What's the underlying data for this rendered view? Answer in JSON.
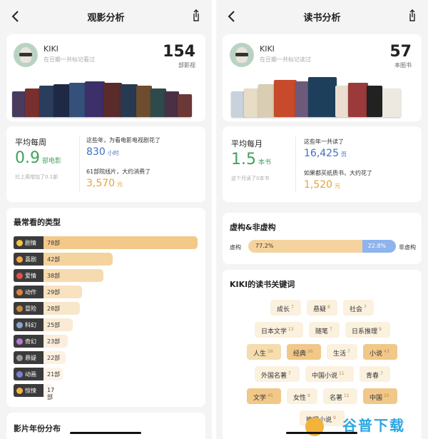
{
  "left": {
    "title": "观影分析",
    "profile": {
      "name": "KIKI",
      "subtitle": "在豆瓣一共标记看过",
      "count": "154",
      "count_label": "部影视"
    },
    "stats": {
      "avg_label": "平均每周",
      "avg_value": "0.9",
      "avg_unit": "部电影",
      "avg_note": "比上周增加了0.1部",
      "time_text": "这些年，为看电影电视剧花了",
      "time_value": "830",
      "time_unit": "小时",
      "cost_text": "61部院线片，大约消费了",
      "cost_value": "3,570",
      "cost_unit": "元"
    },
    "genres": {
      "title": "最常看的类型",
      "items": [
        {
          "name": "剧情",
          "value": "78部",
          "count": 78,
          "color": "#f3c98a",
          "icon": "drama-icon"
        },
        {
          "name": "喜剧",
          "value": "42部",
          "count": 42,
          "color": "#f5d39e",
          "icon": "comedy-icon"
        },
        {
          "name": "爱情",
          "value": "38部",
          "count": 38,
          "color": "#f6dbb0",
          "icon": "romance-icon"
        },
        {
          "name": "动作",
          "value": "29部",
          "count": 29,
          "color": "#f8e2bf",
          "icon": "action-icon"
        },
        {
          "name": "冒险",
          "value": "28部",
          "count": 28,
          "color": "#f9e7ca",
          "icon": "adventure-icon"
        },
        {
          "name": "科幻",
          "value": "25部",
          "count": 25,
          "color": "#faebd4",
          "icon": "scifi-icon"
        },
        {
          "name": "奇幻",
          "value": "23部",
          "count": 23,
          "color": "#fbeedb",
          "icon": "fantasy-icon"
        },
        {
          "name": "悬疑",
          "value": "22部",
          "count": 22,
          "color": "#fcf1e2",
          "icon": "mystery-icon"
        },
        {
          "name": "动画",
          "value": "21部",
          "count": 21,
          "color": "#fcf3e7",
          "icon": "animation-icon"
        },
        {
          "name": "惊悚",
          "value": "17部",
          "count": 17,
          "color": "#fdf6ec",
          "icon": "thriller-icon"
        }
      ]
    },
    "year_title": "影片年份分布"
  },
  "right": {
    "title": "读书分析",
    "profile": {
      "name": "KIKI",
      "subtitle": "在豆瓣一共标记读过",
      "count": "57",
      "count_label": "本图书"
    },
    "stats": {
      "avg_label": "平均每月",
      "avg_value": "1.5",
      "avg_unit": "本书",
      "avg_note": "这个月读了0本书",
      "pages_text": "这些年一共读了",
      "pages_value": "16,425",
      "pages_unit": "页",
      "cost_text": "如果都买纸质书，大约花了",
      "cost_value": "1,520",
      "cost_unit": "元"
    },
    "fiction": {
      "title": "虚构&非虚构",
      "left_label": "虚构",
      "right_label": "非虚构",
      "fiction_pct": "77.2%",
      "nonfiction_pct": "22.8%",
      "fiction_share": 77.2
    },
    "keywords": {
      "title": "KIKI的读书关键词",
      "rows": [
        [
          {
            "word": "成长",
            "n": "7",
            "level": 1
          },
          {
            "word": "悬疑",
            "n": "8",
            "level": 1
          },
          {
            "word": "社会",
            "n": "7",
            "level": 1
          }
        ],
        [
          {
            "word": "日本文学",
            "n": "13",
            "level": 1
          },
          {
            "word": "随笔",
            "n": "7",
            "level": 1
          },
          {
            "word": "日系推理",
            "n": "9",
            "level": 1
          }
        ],
        [
          {
            "word": "人生",
            "n": "16",
            "level": 2
          },
          {
            "word": "经典",
            "n": "26",
            "level": 3
          },
          {
            "word": "生活",
            "n": "7",
            "level": 1
          },
          {
            "word": "小说",
            "n": "43",
            "level": 3
          }
        ],
        [
          {
            "word": "外国名著",
            "n": "7",
            "level": 1
          },
          {
            "word": "中国小说",
            "n": "11",
            "level": 1
          },
          {
            "word": "青春",
            "n": "7",
            "level": 1
          }
        ],
        [
          {
            "word": "文学",
            "n": "45",
            "level": 3
          },
          {
            "word": "女性",
            "n": "9",
            "level": 1
          },
          {
            "word": "名著",
            "n": "11",
            "level": 1
          },
          {
            "word": "中国",
            "n": "25",
            "level": 3
          }
        ],
        [
          {
            "word": "推理小说",
            "n": "9",
            "level": 1
          }
        ]
      ]
    },
    "watermark": "谷普下载"
  }
}
